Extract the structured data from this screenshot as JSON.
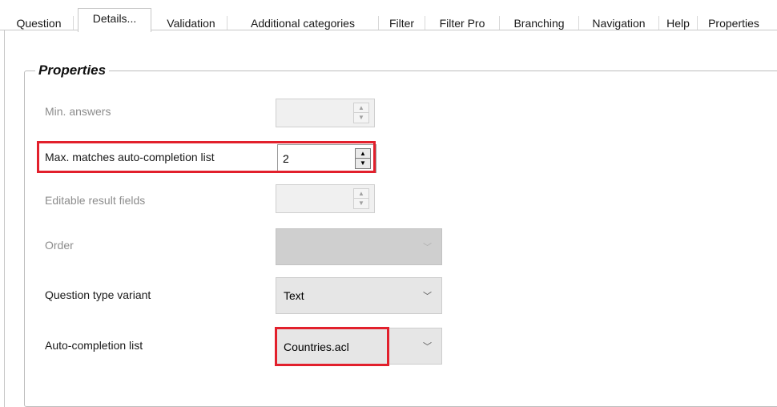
{
  "tabs": [
    {
      "label": "Question"
    },
    {
      "label": "Details..."
    },
    {
      "label": "Validation"
    },
    {
      "label": "Additional categories"
    },
    {
      "label": "Filter"
    },
    {
      "label": "Filter Pro"
    },
    {
      "label": "Branching"
    },
    {
      "label": "Navigation"
    },
    {
      "label": "Help"
    },
    {
      "label": "Properties"
    }
  ],
  "group": {
    "title": "Properties"
  },
  "fields": {
    "min_answers": {
      "label": "Min. answers",
      "value": ""
    },
    "max_matches": {
      "label": "Max. matches auto-completion list",
      "value": "2"
    },
    "editable_result": {
      "label": "Editable result fields",
      "value": ""
    },
    "order": {
      "label": "Order",
      "value": ""
    },
    "question_type_variant": {
      "label": "Question type variant",
      "value": "Text"
    },
    "auto_completion_list": {
      "label": "Auto-completion list",
      "value": "Countries.acl"
    }
  },
  "icons": {
    "spin_up": "spin-up-icon",
    "spin_down": "spin-down-icon",
    "dropdown": "chevron-down-icon"
  },
  "colors": {
    "highlight": "#e2202c",
    "disabled_text": "#8d8d8d"
  }
}
